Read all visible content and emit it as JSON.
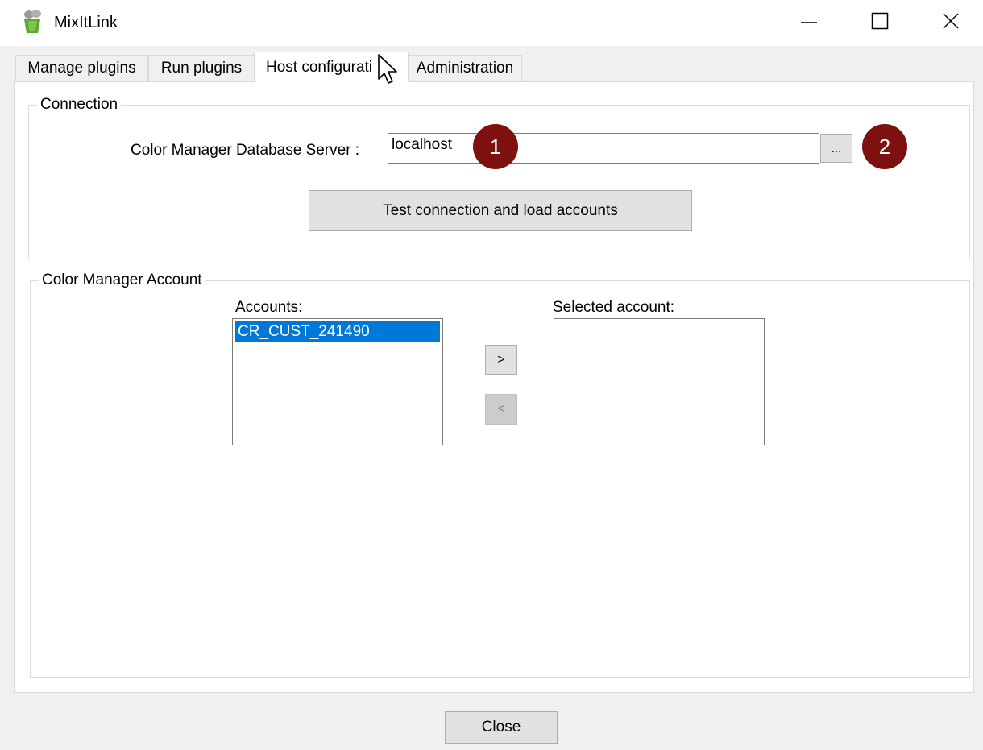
{
  "window": {
    "title": "MixItLink",
    "controls": {
      "minimize": "minimize-icon",
      "maximize": "maximize-icon",
      "close": "close-icon"
    }
  },
  "tabs": [
    {
      "label": "Manage plugins",
      "active": false
    },
    {
      "label": "Run plugins",
      "active": false
    },
    {
      "label": "Host configurati",
      "active": true
    },
    {
      "label": "Administration",
      "active": false
    }
  ],
  "connection": {
    "legend": "Connection",
    "server_label": "Color Manager Database Server :",
    "server_value": "localhost",
    "browse_label": "...",
    "test_button": "Test connection and load accounts",
    "annotations": [
      "1",
      "2"
    ],
    "annotation_color": "#7f1010"
  },
  "account": {
    "legend": "Color Manager Account",
    "accounts_label": "Accounts:",
    "accounts": [
      "CR_CUST_241490"
    ],
    "selected_label": "Selected account:",
    "selected_accounts": [],
    "add_label": ">",
    "remove_label": "<"
  },
  "footer": {
    "close_label": "Close"
  },
  "colors": {
    "selection": "#0078d7",
    "window_bg": "#f0f0f0"
  }
}
